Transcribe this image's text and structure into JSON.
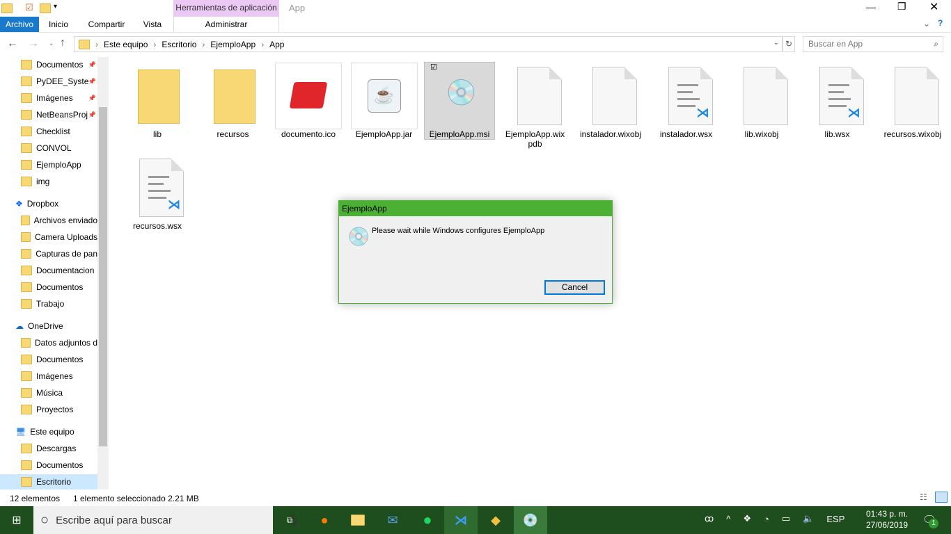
{
  "titlebar": {
    "context_tab": "Herramientas de aplicación",
    "title": "App"
  },
  "ribbon": {
    "tabs": [
      "Archivo",
      "Inicio",
      "Compartir",
      "Vista"
    ],
    "context_tab": "Administrar"
  },
  "address": {
    "crumbs": [
      "Este equipo",
      "Escritorio",
      "EjemploApp",
      "App"
    ],
    "search_placeholder": "Buscar en App"
  },
  "sidebar": {
    "items": [
      {
        "label": "Documentos",
        "pinned": true,
        "level": 1
      },
      {
        "label": "PyDEE_Syster",
        "pinned": true,
        "level": 1
      },
      {
        "label": "Imágenes",
        "pinned": true,
        "level": 1
      },
      {
        "label": "NetBeansProj",
        "pinned": true,
        "level": 1
      },
      {
        "label": "Checklist",
        "level": 1
      },
      {
        "label": "CONVOL",
        "level": 1
      },
      {
        "label": "EjemploApp",
        "level": 1
      },
      {
        "label": "img",
        "level": 1
      },
      {
        "label": "Dropbox",
        "level": 0
      },
      {
        "label": "Archivos enviado",
        "level": 1
      },
      {
        "label": "Camera Uploads",
        "level": 1
      },
      {
        "label": "Capturas de pan",
        "level": 1
      },
      {
        "label": "Documentacion",
        "level": 1
      },
      {
        "label": "Documentos",
        "level": 1
      },
      {
        "label": "Trabajo",
        "level": 1
      },
      {
        "label": "OneDrive",
        "level": 0
      },
      {
        "label": "Datos adjuntos d",
        "level": 1
      },
      {
        "label": "Documentos",
        "level": 1
      },
      {
        "label": "Imágenes",
        "level": 1
      },
      {
        "label": "Música",
        "level": 1
      },
      {
        "label": "Proyectos",
        "level": 1
      },
      {
        "label": "Este equipo",
        "level": 0
      },
      {
        "label": "Descargas",
        "level": 1
      },
      {
        "label": "Documentos",
        "level": 1
      },
      {
        "label": "Escritorio",
        "level": 1,
        "selected": true
      }
    ]
  },
  "files": [
    {
      "name": "lib",
      "type": "folder"
    },
    {
      "name": "recursos",
      "type": "folder"
    },
    {
      "name": "documento.ico",
      "type": "ico"
    },
    {
      "name": "EjemploApp.jar",
      "type": "jar"
    },
    {
      "name": "EjemploApp.msi",
      "type": "msi",
      "selected": true
    },
    {
      "name": "EjemploApp.wixpdb",
      "type": "blank"
    },
    {
      "name": "instalador.wixobj",
      "type": "blank"
    },
    {
      "name": "instalador.wsx",
      "type": "vscode"
    },
    {
      "name": "lib.wixobj",
      "type": "blank"
    },
    {
      "name": "lib.wsx",
      "type": "vscode"
    },
    {
      "name": "recursos.wixobj",
      "type": "blank"
    },
    {
      "name": "recursos.wsx",
      "type": "vscode"
    }
  ],
  "status": {
    "count": "12 elementos",
    "selection": "1 elemento seleccionado  2.21 MB"
  },
  "dialog": {
    "title": "EjemploApp",
    "message": "Please wait while Windows configures EjemploApp",
    "cancel": "Cancel",
    "accent": "#4cb034"
  },
  "taskbar": {
    "search_placeholder": "Escribe aquí para buscar",
    "lang": "ESP",
    "time": "01:43 p. m.",
    "date": "27/06/2019",
    "notifications": "1",
    "color": "#1e4d1e"
  }
}
